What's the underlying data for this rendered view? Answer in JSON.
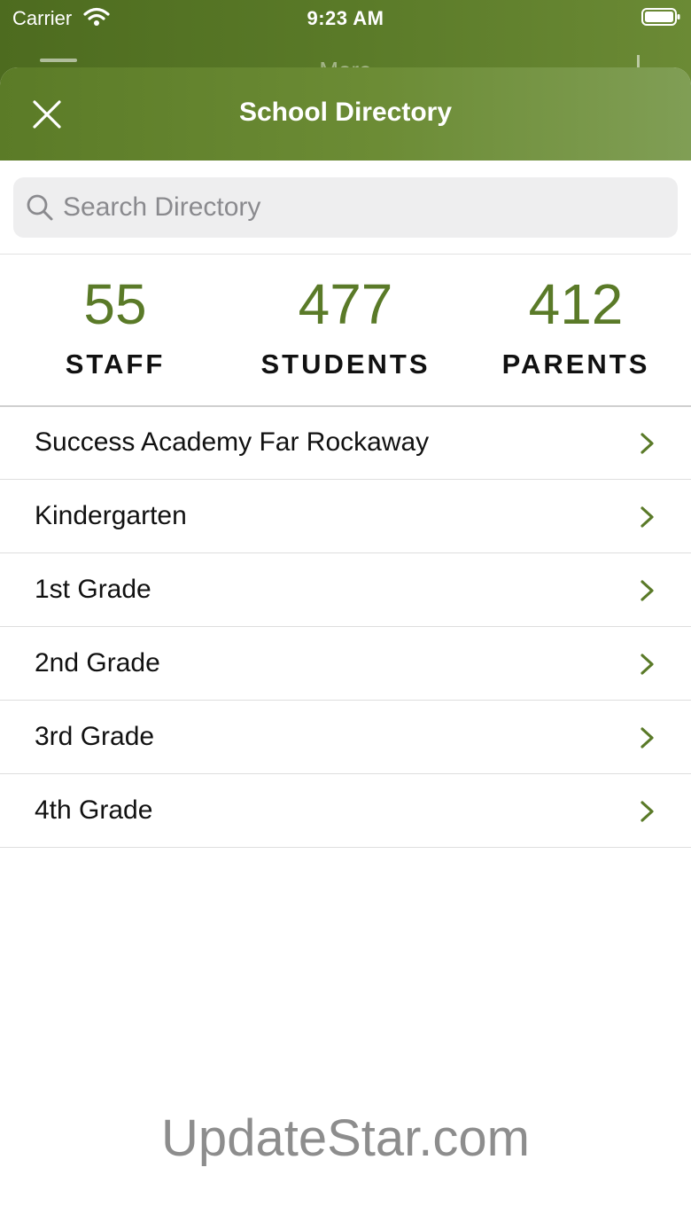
{
  "status_bar": {
    "carrier": "Carrier",
    "time": "9:23 AM"
  },
  "background_app": {
    "title": "More"
  },
  "header": {
    "title": "School Directory"
  },
  "search": {
    "placeholder": "Search Directory",
    "value": ""
  },
  "stats": [
    {
      "count": "55",
      "label": "STAFF"
    },
    {
      "count": "477",
      "label": "STUDENTS"
    },
    {
      "count": "412",
      "label": "PARENTS"
    }
  ],
  "list": [
    {
      "label": "Success Academy Far Rockaway"
    },
    {
      "label": "Kindergarten"
    },
    {
      "label": "1st Grade"
    },
    {
      "label": "2nd Grade"
    },
    {
      "label": "3rd Grade"
    },
    {
      "label": "4th Grade"
    }
  ],
  "watermark": "UpdateStar.com",
  "colors": {
    "brand_green": "#5a7a28",
    "header_green": "#6c8c35",
    "chevron_green": "#5a7a28"
  },
  "icons": {
    "close": "close-icon",
    "search": "search-icon",
    "chevron": "chevron-right-icon",
    "wifi": "wifi-icon",
    "battery": "battery-icon"
  }
}
